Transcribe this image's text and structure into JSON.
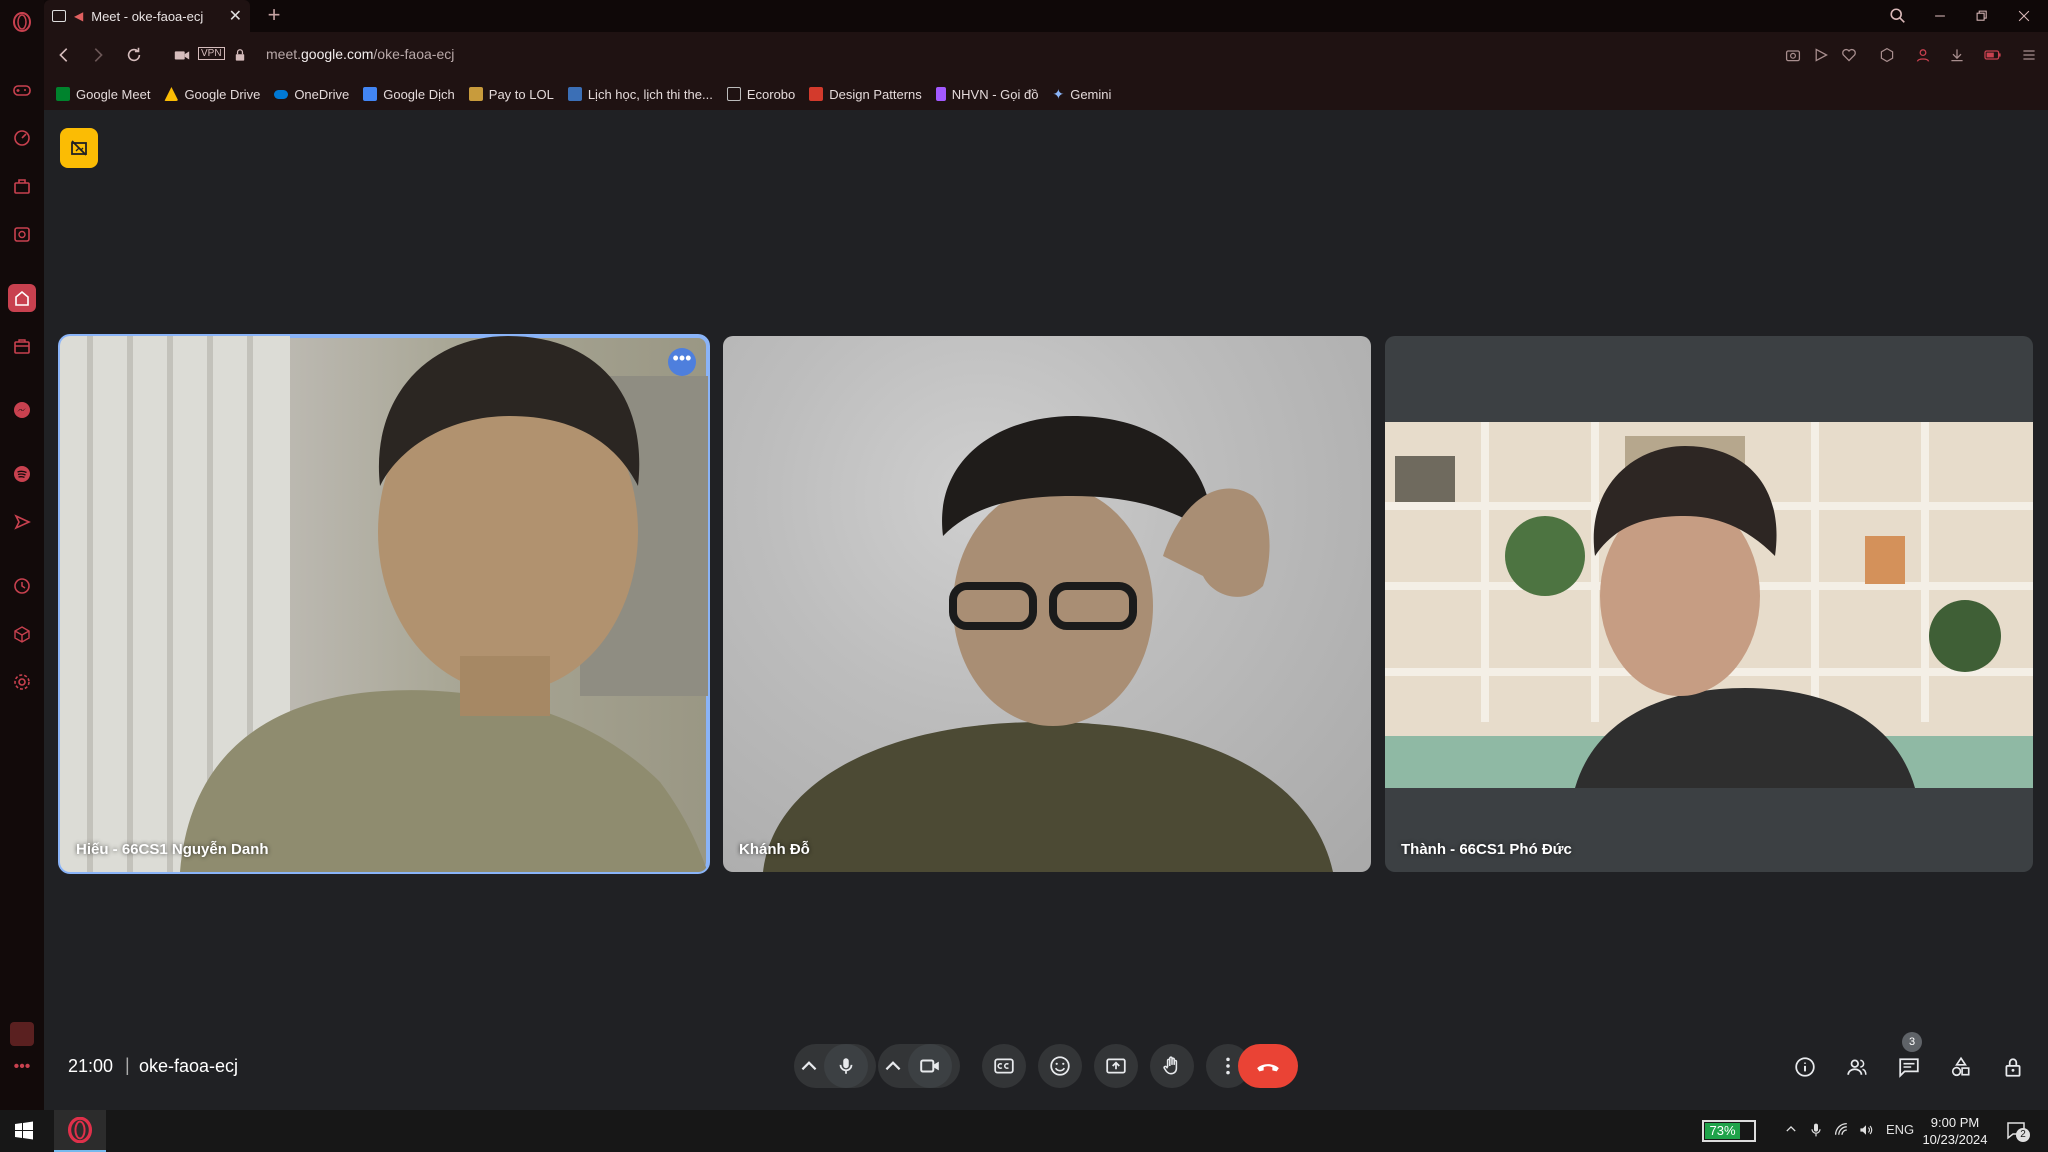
{
  "browser": {
    "tab_title": "Meet - oke-faoa-ecj",
    "url_prefix": "meet.",
    "url_domain": "google.com",
    "url_path": "/oke-faoa-ecj",
    "vpn_label": "VPN"
  },
  "bookmarks": [
    {
      "label": "Google Meet",
      "color": "#00832d"
    },
    {
      "label": "Google Drive",
      "color": "#fbbc04"
    },
    {
      "label": "OneDrive",
      "color": "#0078d4"
    },
    {
      "label": "Google Dịch",
      "color": "#4285f4"
    },
    {
      "label": "Pay to LOL",
      "color": "#c89b3c"
    },
    {
      "label": "Lịch học, lịch thi the...",
      "color": "#3b6fb6"
    },
    {
      "label": "Ecorobo",
      "color": "#888888"
    },
    {
      "label": "Design Patterns",
      "color": "#d33a2c"
    },
    {
      "label": "NHVN - Gọi đồ",
      "color": "#a259ff"
    },
    {
      "label": "Gemini",
      "color": "#8ab4f8"
    }
  ],
  "participants": [
    {
      "name": "Hiếu - 66CS1 Nguyễn Danh",
      "active": true
    },
    {
      "name": "Khánh Đỗ",
      "active": false
    },
    {
      "name": "Thành - 66CS1 Phó Đức",
      "active": false
    }
  ],
  "meeting": {
    "time": "21:00",
    "separator": "|",
    "code": "oke-faoa-ecj",
    "people_count": "3"
  },
  "taskbar": {
    "battery_percent": "73%",
    "battery_level": 0.73,
    "language": "ENG",
    "time": "9:00 PM",
    "date": "10/23/2024",
    "notification_count": "2"
  },
  "colors": {
    "accent": "#8ab4f8",
    "leave": "#ea4335",
    "recording_badge": "#fbbc04",
    "opera_red": "#c8414f"
  }
}
